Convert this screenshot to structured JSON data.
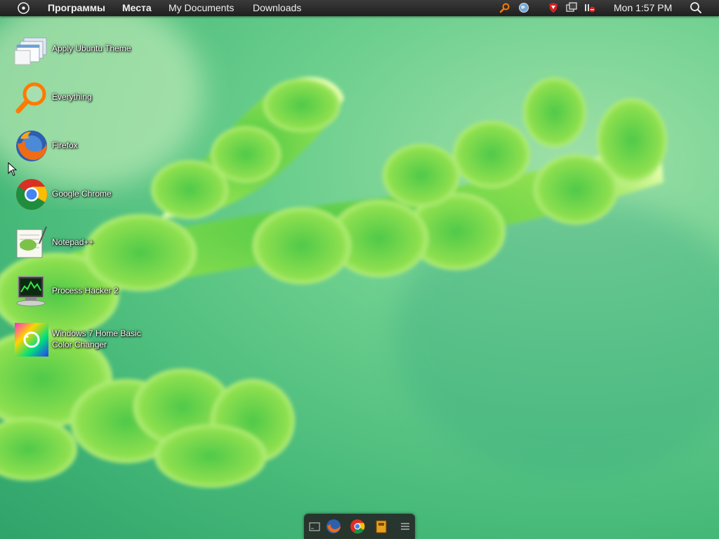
{
  "top_panel": {
    "menus": [
      "Программы",
      "Места",
      "My Documents",
      "Downloads"
    ],
    "clock": "Mon 1:57 PM",
    "tray_icons": [
      "everything-search-icon",
      "network-globe-icon",
      "antivirus-shield-icon",
      "windows-icon",
      "volume-muted-icon"
    ]
  },
  "desktop": {
    "icons": [
      {
        "label": "Apply Ubuntu Theme",
        "icon": "windows-stack-icon"
      },
      {
        "label": "Everything",
        "icon": "magnifier-icon"
      },
      {
        "label": "Firefox",
        "icon": "firefox-icon"
      },
      {
        "label": "Google Chrome",
        "icon": "chrome-icon"
      },
      {
        "label": "Notepad++",
        "icon": "notepad-plus-icon"
      },
      {
        "label": "Process Hacker 2",
        "icon": "process-hacker-icon"
      },
      {
        "label": "Windows 7 Home Basic Color Changer",
        "icon": "color-changer-icon"
      }
    ]
  },
  "dock": {
    "items": [
      "show-desktop-icon",
      "firefox-icon",
      "chrome-icon",
      "notepad-icon",
      "menu-lines-icon"
    ]
  }
}
